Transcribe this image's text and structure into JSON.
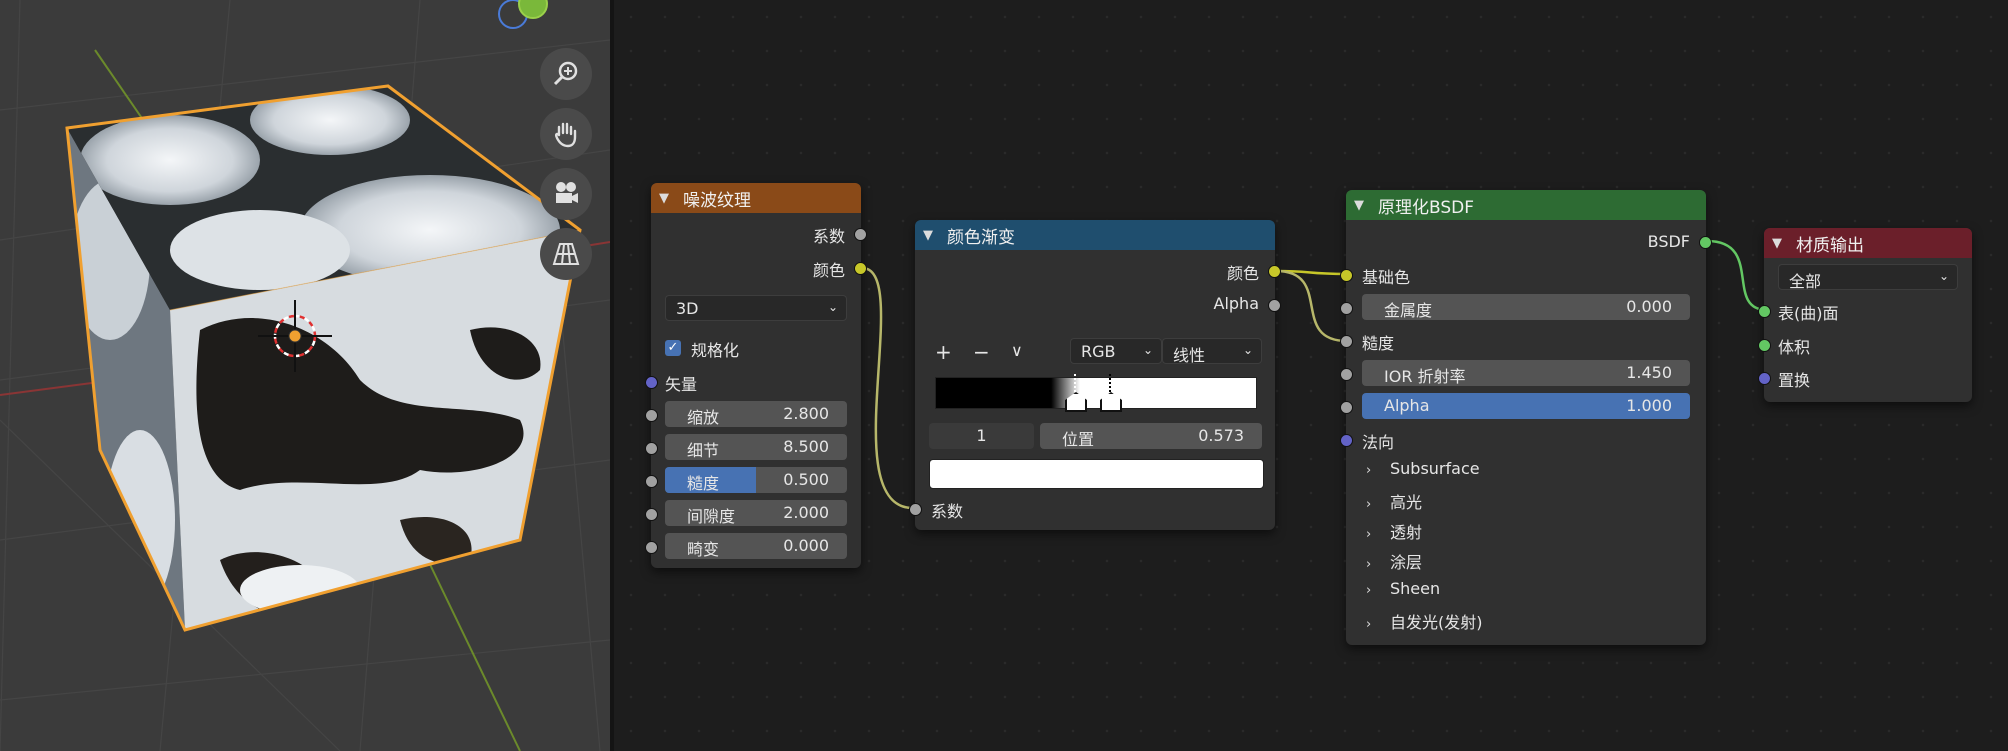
{
  "viewport": {
    "nav_icons": [
      "zoom-icon",
      "hand-pan-icon",
      "camera-icon",
      "grid-perspective-icon"
    ]
  },
  "nodes": {
    "noise": {
      "title": "噪波纹理",
      "header_color": "#8a4a18",
      "outputs": [
        "系数",
        "颜色"
      ],
      "dimension": "3D",
      "normalize_label": "规格化",
      "normalize_checked": true,
      "vector_label": "矢量",
      "fields": [
        {
          "label": "缩放",
          "value": "2.800"
        },
        {
          "label": "细节",
          "value": "8.500"
        },
        {
          "label": "糙度",
          "value": "0.500",
          "fraction": 0.5
        },
        {
          "label": "间隙度",
          "value": "2.000"
        },
        {
          "label": "畸变",
          "value": "0.000"
        }
      ]
    },
    "ramp": {
      "title": "颜色渐变",
      "header_color": "#1f4e6e",
      "outputs": [
        "颜色",
        "Alpha"
      ],
      "add": "+",
      "remove": "−",
      "more": "∨",
      "color_mode": "RGB",
      "interpolation": "线性",
      "stop_index": "1",
      "position_label": "位置",
      "position_value": "0.573",
      "stop_color": "#ffffff",
      "input_label": "系数"
    },
    "bsdf": {
      "title": "原理化BSDF",
      "header_color": "#2d6b33",
      "output": "BSDF",
      "base_color": "基础色",
      "metallic": {
        "label": "金属度",
        "value": "0.000"
      },
      "roughness": "糙度",
      "ior": {
        "label": "IOR 折射率",
        "value": "1.450"
      },
      "alpha": {
        "label": "Alpha",
        "value": "1.000"
      },
      "normal": "法向",
      "panels": [
        "Subsurface",
        "高光",
        "透射",
        "涂层",
        "Sheen",
        "自发光(发射)"
      ]
    },
    "output": {
      "title": "材质输出",
      "header_color": "#6b1f2a",
      "target": "全部",
      "inputs": [
        "表(曲)面",
        "体积",
        "置换"
      ]
    }
  }
}
